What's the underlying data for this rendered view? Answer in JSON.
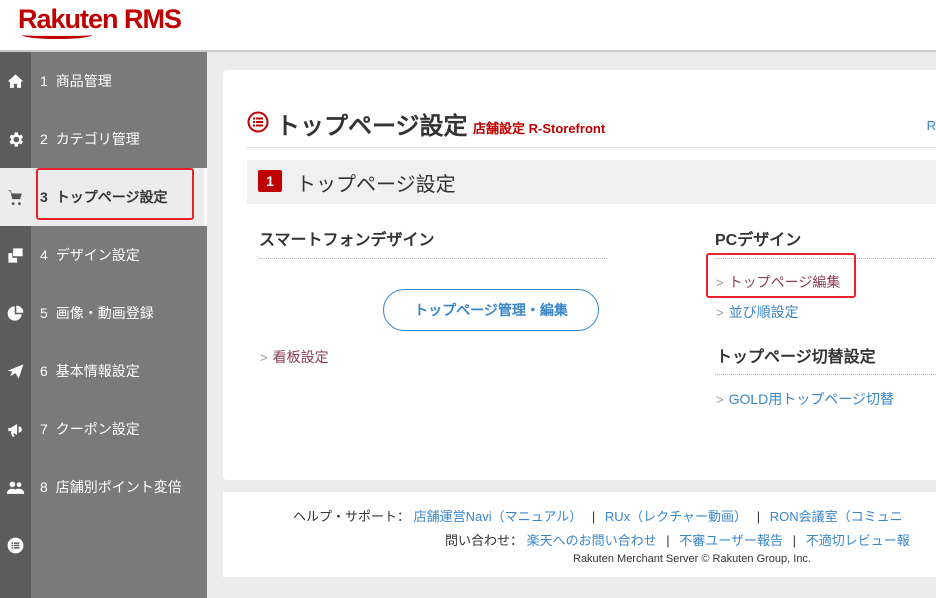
{
  "app": {
    "logo": "Rakuten RMS"
  },
  "sidebar": {
    "items": [
      {
        "num": "1",
        "label": "商品管理",
        "icon": "home-icon"
      },
      {
        "num": "2",
        "label": "カテゴリ管理",
        "icon": "gear-icon"
      },
      {
        "num": "3",
        "label": "トップページ設定",
        "icon": "cart-icon",
        "active": true
      },
      {
        "num": "4",
        "label": "デザイン設定",
        "icon": "design-icon"
      },
      {
        "num": "5",
        "label": "画像・動画登録",
        "icon": "pie-chart-icon"
      },
      {
        "num": "6",
        "label": "基本情報設定",
        "icon": "paper-plane-icon"
      },
      {
        "num": "7",
        "label": "クーポン設定",
        "icon": "megaphone-icon"
      },
      {
        "num": "8",
        "label": "店舗別ポイント変倍",
        "icon": "users-icon"
      }
    ],
    "extra_icon": "list-icon"
  },
  "page": {
    "title": "トップページ設定",
    "subtitle": "店舗設定 R-Storefront",
    "right_link": "R",
    "section_number": "1",
    "section_title": "トップページ設定"
  },
  "smartphone": {
    "title": "スマートフォンデザイン",
    "button": "トップページ管理・編集",
    "link": "看板設定"
  },
  "pc": {
    "title": "PCデザイン",
    "links": [
      "トップページ編集",
      "並び順設定"
    ],
    "switch_title": "トップページ切替設定",
    "switch_link": "GOLD用トップページ切替"
  },
  "footer": {
    "help_label": "ヘルプ・サポート：",
    "help_links": [
      "店舗運営Navi（マニュアル）",
      "RUx（レクチャー動画）",
      "RON会議室（コミュニ"
    ],
    "contact_label": "問い合わせ：",
    "contact_links": [
      "楽天へのお問い合わせ",
      "不審ユーザー報告",
      "不適切レビュー報"
    ],
    "separator": "|",
    "copyright": "Rakuten Merchant Server © Rakuten Group, Inc."
  },
  "colors": {
    "brand": "#bf0000",
    "link": "#3a87c8",
    "highlight": "#e8222a"
  }
}
